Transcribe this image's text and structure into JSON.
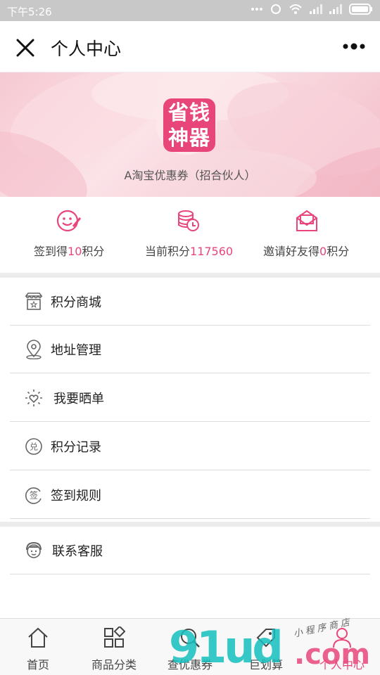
{
  "status_bar": {
    "time": "下午5:26"
  },
  "header": {
    "title": "个人中心"
  },
  "profile": {
    "logo_line1": "省钱",
    "logo_line2": "神器",
    "shop_name": "A淘宝优惠券（招合伙人）"
  },
  "stats": [
    {
      "prefix": "签到得",
      "value": "10",
      "suffix": "积分",
      "icon": "sign-in-smile-icon"
    },
    {
      "prefix": "当前积分",
      "value": "117560",
      "suffix": "",
      "icon": "coins-icon"
    },
    {
      "prefix": "邀请好友得",
      "value": "0",
      "suffix": "积分",
      "icon": "envelope-icon"
    }
  ],
  "menu_group1": [
    {
      "label": "积分商城",
      "icon": "store-icon"
    },
    {
      "label": "地址管理",
      "icon": "location-pin-icon"
    },
    {
      "label": "我要晒单",
      "icon": "sun-heart-icon"
    },
    {
      "label": "积分记录",
      "icon": "exchange-icon"
    },
    {
      "label": "签到规则",
      "icon": "sign-rule-icon"
    }
  ],
  "menu_group2": [
    {
      "label": "联系客服",
      "icon": "customer-service-icon"
    }
  ],
  "tabs": [
    {
      "label": "首页",
      "icon": "home-icon"
    },
    {
      "label": "商品分类",
      "icon": "category-icon"
    },
    {
      "label": "查优惠券",
      "icon": "search-icon"
    },
    {
      "label": "巨划算",
      "icon": "tag-icon"
    },
    {
      "label": "个人中心",
      "icon": "user-icon",
      "active": true
    }
  ],
  "watermark": {
    "big": "91ud",
    "com": ".com",
    "small": "小程序商店"
  },
  "colors": {
    "accent": "#e8467a",
    "separator": "#ececec",
    "statusbar": "#c8c8c8"
  }
}
